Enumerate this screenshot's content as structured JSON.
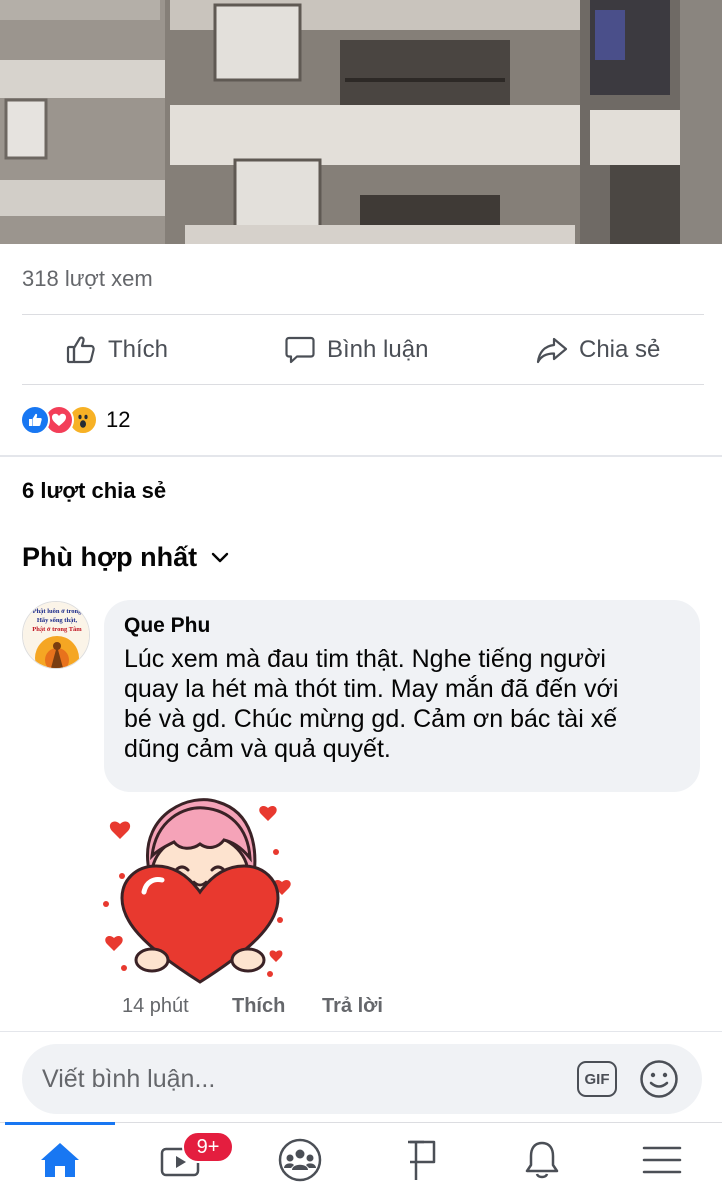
{
  "post": {
    "views_text": "318 lượt xem",
    "shares_text": "6 lượt chia sẻ",
    "reaction_count": "12"
  },
  "actions": {
    "like_label": "Thích",
    "comment_label": "Bình luận",
    "share_label": "Chia sẻ"
  },
  "comments_sort": {
    "label": "Phù hợp nhất"
  },
  "comment": {
    "author": "Que Phu",
    "text": "Lúc xem mà đau tim thật. Nghe tiếng người\nquay la hét mà thót tim. May mắn đã đến với\nbé và gd. Chúc mừng gd. Cảm ơn bác tài xế\ndũng cảm và quả quyết.",
    "time": "14 phút",
    "like_label": "Thích",
    "reply_label": "Trả lời",
    "avatar_text": [
      "Phật luôn ở trong",
      "Hãy sống thật,",
      "Phật ở trong Tâm"
    ]
  },
  "composer": {
    "placeholder": "Viết bình luận...",
    "gif_label": "GIF"
  },
  "tabbar": {
    "video_badge": "9+"
  },
  "icons": {
    "like": "thumbs-up-icon",
    "comment": "speech-bubble-icon",
    "share": "share-arrow-icon",
    "home": "home-icon",
    "watch": "video-icon",
    "groups": "groups-icon",
    "pages": "flag-icon",
    "notifications": "bell-icon",
    "menu": "menu-icon"
  },
  "colors": {
    "accent": "#1877f2",
    "badge": "#e41e3f",
    "bubble": "#f0f2f5",
    "secondary_text": "#65676b"
  }
}
